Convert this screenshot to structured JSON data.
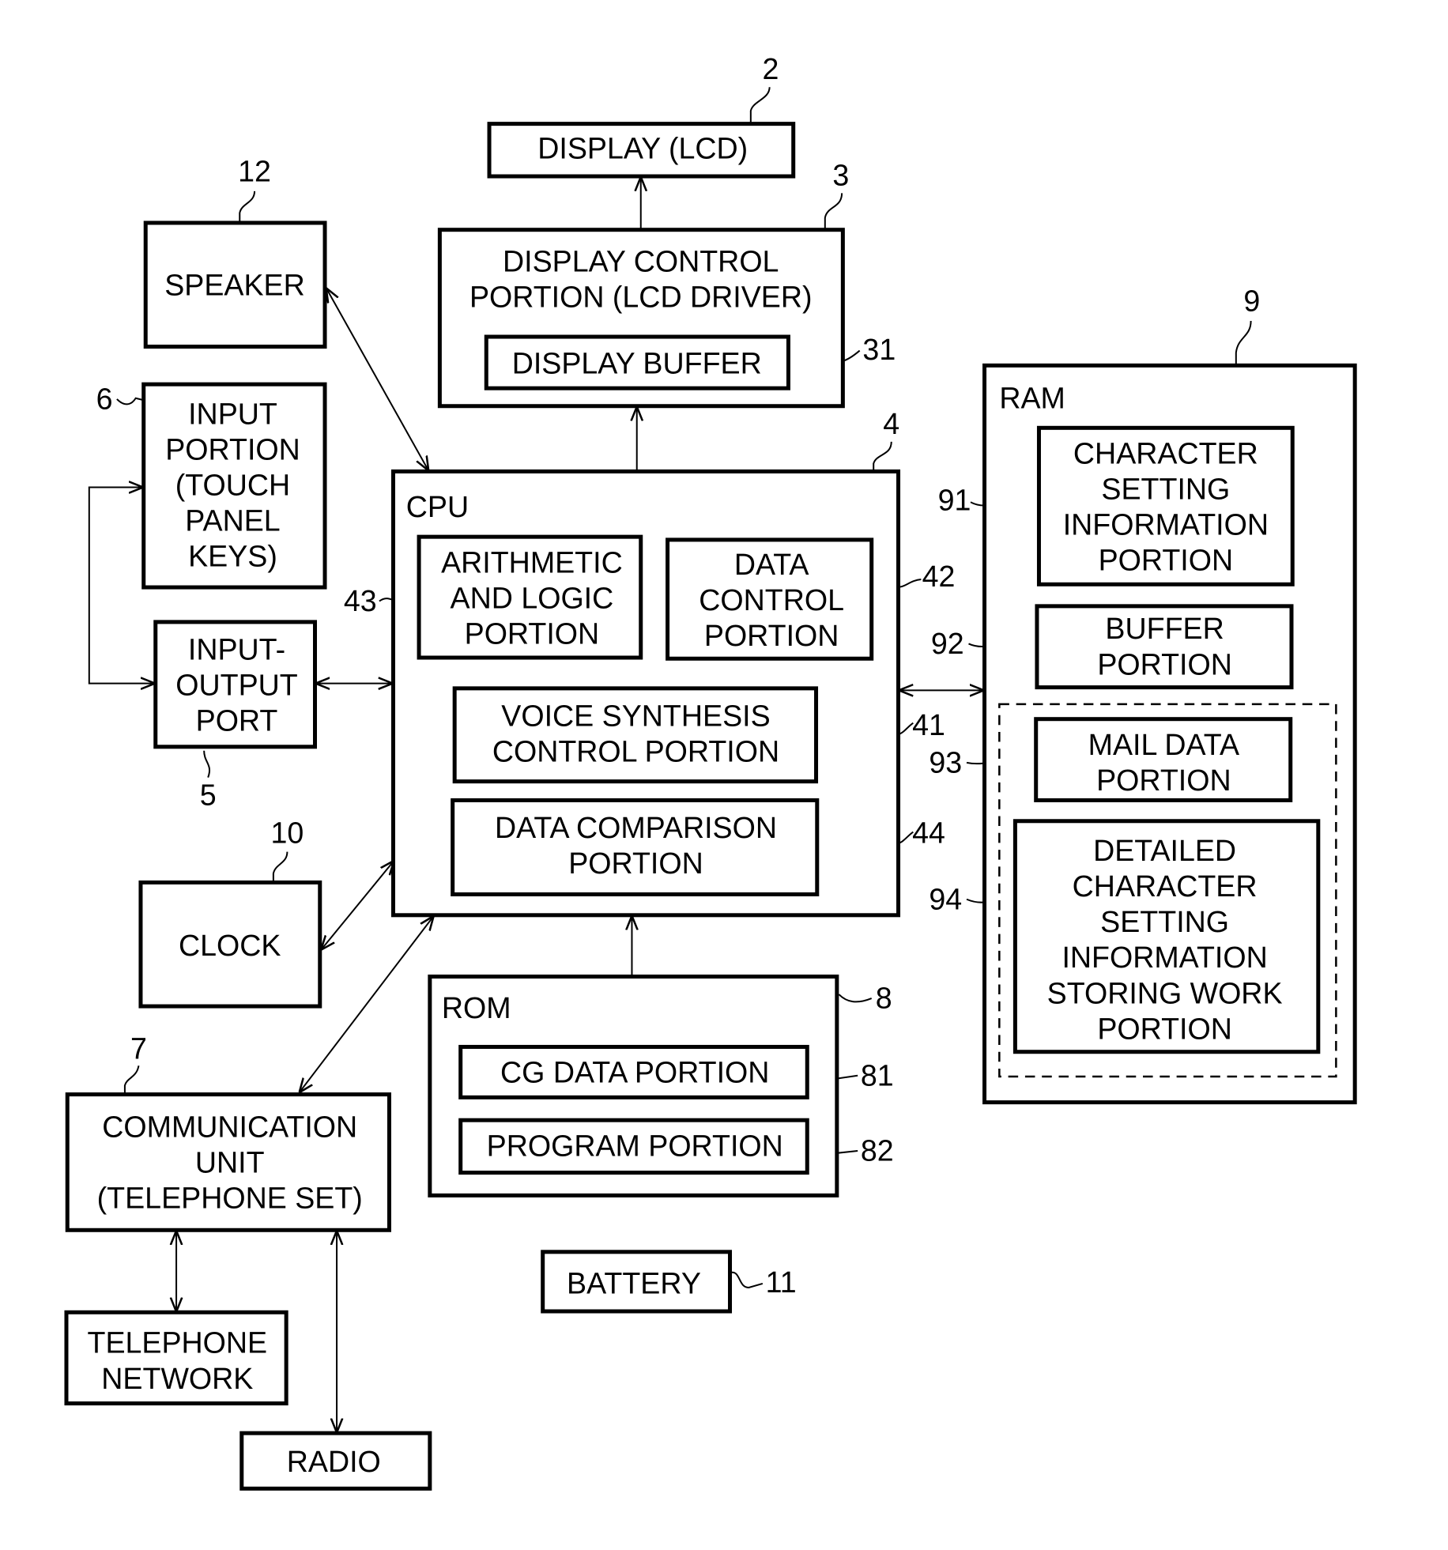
{
  "diagram": {
    "type": "block-diagram",
    "blocks": {
      "display": {
        "ref": "2",
        "lines": [
          "DISPLAY (LCD)"
        ]
      },
      "display_control": {
        "ref": "3",
        "lines": [
          "DISPLAY CONTROL",
          "PORTION (LCD DRIVER)"
        ]
      },
      "display_buffer": {
        "ref": "31",
        "lines": [
          "DISPLAY BUFFER"
        ]
      },
      "speaker": {
        "ref": "12",
        "lines": [
          "SPEAKER"
        ]
      },
      "input_portion": {
        "ref": "6",
        "lines": [
          "INPUT",
          "PORTION",
          "(TOUCH",
          "PANEL",
          "KEYS)"
        ]
      },
      "io_port": {
        "ref": "5",
        "lines": [
          "INPUT-",
          "OUTPUT",
          "PORT"
        ]
      },
      "cpu": {
        "ref": "4",
        "title": "CPU"
      },
      "alu": {
        "ref": "43",
        "lines": [
          "ARITHMETIC",
          "AND LOGIC",
          "PORTION"
        ]
      },
      "data_control": {
        "ref": "42",
        "lines": [
          "DATA",
          "CONTROL",
          "PORTION"
        ]
      },
      "voice_synthesis": {
        "ref": "41",
        "lines": [
          "VOICE SYNTHESIS",
          "CONTROL PORTION"
        ]
      },
      "data_comparison": {
        "ref": "44",
        "lines": [
          "DATA COMPARISON",
          "PORTION"
        ]
      },
      "clock": {
        "ref": "10",
        "lines": [
          "CLOCK"
        ]
      },
      "communication": {
        "ref": "7",
        "lines": [
          "COMMUNICATION",
          "UNIT",
          "(TELEPHONE SET)"
        ]
      },
      "telephone_network": {
        "lines": [
          "TELEPHONE",
          "NETWORK"
        ]
      },
      "radio": {
        "lines": [
          "RADIO"
        ]
      },
      "rom": {
        "ref": "8",
        "title": "ROM"
      },
      "cg_data": {
        "ref": "81",
        "lines": [
          "CG DATA PORTION"
        ]
      },
      "program": {
        "ref": "82",
        "lines": [
          "PROGRAM PORTION"
        ]
      },
      "battery": {
        "ref": "11",
        "lines": [
          "BATTERY"
        ]
      },
      "ram": {
        "ref": "9",
        "title": "RAM"
      },
      "char_setting": {
        "ref": "91",
        "lines": [
          "CHARACTER",
          "SETTING",
          "INFORMATION",
          "PORTION"
        ]
      },
      "buffer": {
        "ref": "92",
        "lines": [
          "BUFFER",
          "PORTION"
        ]
      },
      "mail_data": {
        "ref": "93",
        "lines": [
          "MAIL DATA",
          "PORTION"
        ]
      },
      "detailed_char": {
        "ref": "94",
        "lines": [
          "DETAILED",
          "CHARACTER",
          "SETTING",
          "INFORMATION",
          "STORING WORK",
          "PORTION"
        ]
      }
    },
    "connections": [
      {
        "from": "display_control",
        "to": "display",
        "kind": "one-way"
      },
      {
        "from": "cpu",
        "to": "display_control",
        "kind": "one-way"
      },
      {
        "from": "cpu",
        "to": "speaker",
        "kind": "two-way"
      },
      {
        "from": "io_port",
        "to": "input_portion",
        "kind": "two-way"
      },
      {
        "from": "io_port",
        "to": "cpu",
        "kind": "two-way"
      },
      {
        "from": "cpu",
        "to": "clock",
        "kind": "two-way"
      },
      {
        "from": "cpu",
        "to": "communication",
        "kind": "two-way"
      },
      {
        "from": "rom",
        "to": "cpu",
        "kind": "one-way"
      },
      {
        "from": "cpu",
        "to": "ram",
        "kind": "two-way"
      },
      {
        "from": "communication",
        "to": "telephone_network",
        "kind": "two-way"
      },
      {
        "from": "communication",
        "to": "radio",
        "kind": "two-way"
      }
    ]
  }
}
